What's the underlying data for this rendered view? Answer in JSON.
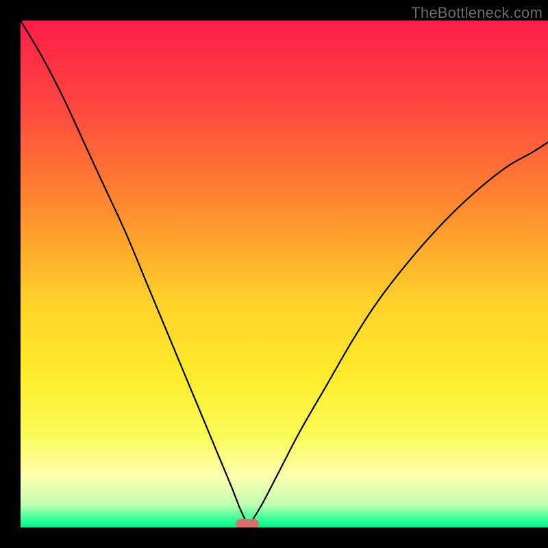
{
  "watermark": "TheBottleneck.com",
  "chart_data": {
    "type": "line",
    "title": "",
    "xlabel": "",
    "ylabel": "",
    "xlim": [
      0,
      100
    ],
    "ylim": [
      0,
      100
    ],
    "axis_visible": false,
    "background": {
      "type": "vertical_gradient",
      "stops": [
        {
          "offset": 0.0,
          "color": "#ff1c4a"
        },
        {
          "offset": 0.18,
          "color": "#ff4a3e"
        },
        {
          "offset": 0.38,
          "color": "#ff8f2e"
        },
        {
          "offset": 0.55,
          "color": "#ffd02a"
        },
        {
          "offset": 0.7,
          "color": "#feec2b"
        },
        {
          "offset": 0.82,
          "color": "#fbfb58"
        },
        {
          "offset": 0.9,
          "color": "#fdffb0"
        },
        {
          "offset": 0.955,
          "color": "#c0ffb0"
        },
        {
          "offset": 0.985,
          "color": "#2fff98"
        },
        {
          "offset": 1.0,
          "color": "#00f08b"
        }
      ]
    },
    "series": [
      {
        "name": "left-branch",
        "x": [
          0,
          4,
          8,
          12,
          16,
          20,
          24,
          28,
          32,
          36,
          38,
          40,
          41.5,
          42.8,
          43.0
        ],
        "y": [
          100,
          93,
          85,
          76,
          67,
          58,
          48,
          38,
          28,
          18,
          13,
          8,
          4,
          1,
          0
        ]
      },
      {
        "name": "right-branch",
        "x": [
          43.0,
          44.0,
          46,
          49,
          53,
          58,
          63,
          68,
          74,
          80,
          86,
          92,
          97,
          100
        ],
        "y": [
          0,
          1.5,
          5,
          11,
          19,
          28,
          37,
          45,
          53,
          60,
          66,
          71,
          74,
          76
        ]
      }
    ],
    "marker": {
      "name": "bottleneck-point",
      "x": 43,
      "y": 0,
      "color": "#d9706d",
      "shape": "pill"
    }
  }
}
